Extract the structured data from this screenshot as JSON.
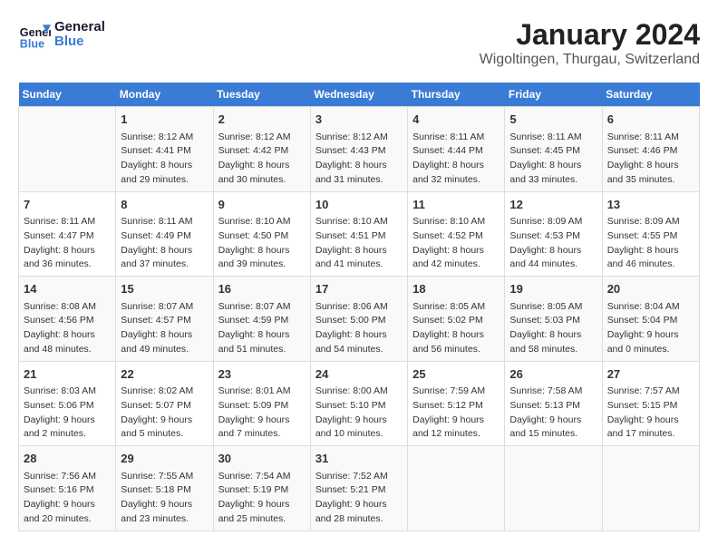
{
  "logo": {
    "line1": "General",
    "line2": "Blue"
  },
  "title": "January 2024",
  "subtitle": "Wigoltingen, Thurgau, Switzerland",
  "headers": [
    "Sunday",
    "Monday",
    "Tuesday",
    "Wednesday",
    "Thursday",
    "Friday",
    "Saturday"
  ],
  "weeks": [
    [
      {
        "day": "",
        "content": ""
      },
      {
        "day": "1",
        "content": "Sunrise: 8:12 AM\nSunset: 4:41 PM\nDaylight: 8 hours\nand 29 minutes."
      },
      {
        "day": "2",
        "content": "Sunrise: 8:12 AM\nSunset: 4:42 PM\nDaylight: 8 hours\nand 30 minutes."
      },
      {
        "day": "3",
        "content": "Sunrise: 8:12 AM\nSunset: 4:43 PM\nDaylight: 8 hours\nand 31 minutes."
      },
      {
        "day": "4",
        "content": "Sunrise: 8:11 AM\nSunset: 4:44 PM\nDaylight: 8 hours\nand 32 minutes."
      },
      {
        "day": "5",
        "content": "Sunrise: 8:11 AM\nSunset: 4:45 PM\nDaylight: 8 hours\nand 33 minutes."
      },
      {
        "day": "6",
        "content": "Sunrise: 8:11 AM\nSunset: 4:46 PM\nDaylight: 8 hours\nand 35 minutes."
      }
    ],
    [
      {
        "day": "7",
        "content": "Sunrise: 8:11 AM\nSunset: 4:47 PM\nDaylight: 8 hours\nand 36 minutes."
      },
      {
        "day": "8",
        "content": "Sunrise: 8:11 AM\nSunset: 4:49 PM\nDaylight: 8 hours\nand 37 minutes."
      },
      {
        "day": "9",
        "content": "Sunrise: 8:10 AM\nSunset: 4:50 PM\nDaylight: 8 hours\nand 39 minutes."
      },
      {
        "day": "10",
        "content": "Sunrise: 8:10 AM\nSunset: 4:51 PM\nDaylight: 8 hours\nand 41 minutes."
      },
      {
        "day": "11",
        "content": "Sunrise: 8:10 AM\nSunset: 4:52 PM\nDaylight: 8 hours\nand 42 minutes."
      },
      {
        "day": "12",
        "content": "Sunrise: 8:09 AM\nSunset: 4:53 PM\nDaylight: 8 hours\nand 44 minutes."
      },
      {
        "day": "13",
        "content": "Sunrise: 8:09 AM\nSunset: 4:55 PM\nDaylight: 8 hours\nand 46 minutes."
      }
    ],
    [
      {
        "day": "14",
        "content": "Sunrise: 8:08 AM\nSunset: 4:56 PM\nDaylight: 8 hours\nand 48 minutes."
      },
      {
        "day": "15",
        "content": "Sunrise: 8:07 AM\nSunset: 4:57 PM\nDaylight: 8 hours\nand 49 minutes."
      },
      {
        "day": "16",
        "content": "Sunrise: 8:07 AM\nSunset: 4:59 PM\nDaylight: 8 hours\nand 51 minutes."
      },
      {
        "day": "17",
        "content": "Sunrise: 8:06 AM\nSunset: 5:00 PM\nDaylight: 8 hours\nand 54 minutes."
      },
      {
        "day": "18",
        "content": "Sunrise: 8:05 AM\nSunset: 5:02 PM\nDaylight: 8 hours\nand 56 minutes."
      },
      {
        "day": "19",
        "content": "Sunrise: 8:05 AM\nSunset: 5:03 PM\nDaylight: 8 hours\nand 58 minutes."
      },
      {
        "day": "20",
        "content": "Sunrise: 8:04 AM\nSunset: 5:04 PM\nDaylight: 9 hours\nand 0 minutes."
      }
    ],
    [
      {
        "day": "21",
        "content": "Sunrise: 8:03 AM\nSunset: 5:06 PM\nDaylight: 9 hours\nand 2 minutes."
      },
      {
        "day": "22",
        "content": "Sunrise: 8:02 AM\nSunset: 5:07 PM\nDaylight: 9 hours\nand 5 minutes."
      },
      {
        "day": "23",
        "content": "Sunrise: 8:01 AM\nSunset: 5:09 PM\nDaylight: 9 hours\nand 7 minutes."
      },
      {
        "day": "24",
        "content": "Sunrise: 8:00 AM\nSunset: 5:10 PM\nDaylight: 9 hours\nand 10 minutes."
      },
      {
        "day": "25",
        "content": "Sunrise: 7:59 AM\nSunset: 5:12 PM\nDaylight: 9 hours\nand 12 minutes."
      },
      {
        "day": "26",
        "content": "Sunrise: 7:58 AM\nSunset: 5:13 PM\nDaylight: 9 hours\nand 15 minutes."
      },
      {
        "day": "27",
        "content": "Sunrise: 7:57 AM\nSunset: 5:15 PM\nDaylight: 9 hours\nand 17 minutes."
      }
    ],
    [
      {
        "day": "28",
        "content": "Sunrise: 7:56 AM\nSunset: 5:16 PM\nDaylight: 9 hours\nand 20 minutes."
      },
      {
        "day": "29",
        "content": "Sunrise: 7:55 AM\nSunset: 5:18 PM\nDaylight: 9 hours\nand 23 minutes."
      },
      {
        "day": "30",
        "content": "Sunrise: 7:54 AM\nSunset: 5:19 PM\nDaylight: 9 hours\nand 25 minutes."
      },
      {
        "day": "31",
        "content": "Sunrise: 7:52 AM\nSunset: 5:21 PM\nDaylight: 9 hours\nand 28 minutes."
      },
      {
        "day": "",
        "content": ""
      },
      {
        "day": "",
        "content": ""
      },
      {
        "day": "",
        "content": ""
      }
    ]
  ]
}
